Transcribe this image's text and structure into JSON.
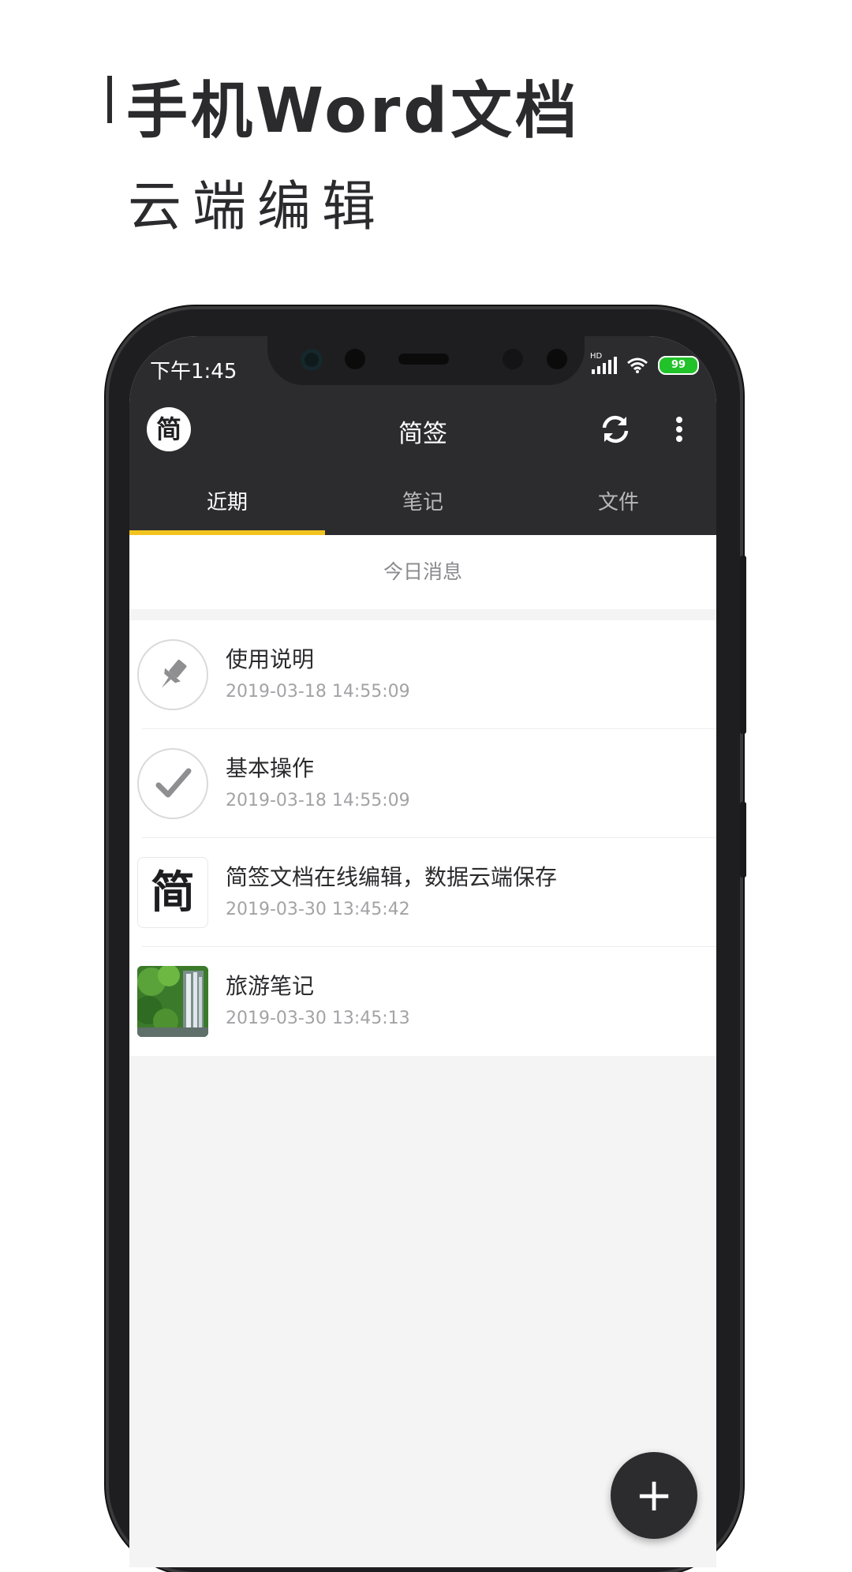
{
  "promo": {
    "headline": "手机Word文档",
    "subline": "云端编辑"
  },
  "status_bar": {
    "time": "下午1:45",
    "network_label": "HD",
    "battery": "99"
  },
  "app_bar": {
    "logo_text": "简",
    "title": "简签",
    "refresh_icon": "refresh-icon",
    "more_icon": "more-vert-icon"
  },
  "tabs": [
    {
      "label": "近期",
      "active": true
    },
    {
      "label": "笔记",
      "active": false
    },
    {
      "label": "文件",
      "active": false
    }
  ],
  "today_header": "今日消息",
  "items": [
    {
      "title": "使用说明",
      "date": "2019-03-18 14:55:09",
      "icon": "pin-icon"
    },
    {
      "title": "基本操作",
      "date": "2019-03-18 14:55:09",
      "icon": "check-icon"
    },
    {
      "title": "简签文档在线编辑，数据云端保存",
      "date": "2019-03-30 13:45:42",
      "icon": "jian-logo",
      "thumb_text": "简"
    },
    {
      "title": "旅游笔记",
      "date": "2019-03-30 13:45:13",
      "icon": "waterfall-photo"
    }
  ],
  "fab_label": "+",
  "colors": {
    "appbar": "#2c2c2f",
    "tab_indicator": "#f3c41f",
    "background": "#f4f4f4",
    "battery": "#22c22a"
  }
}
